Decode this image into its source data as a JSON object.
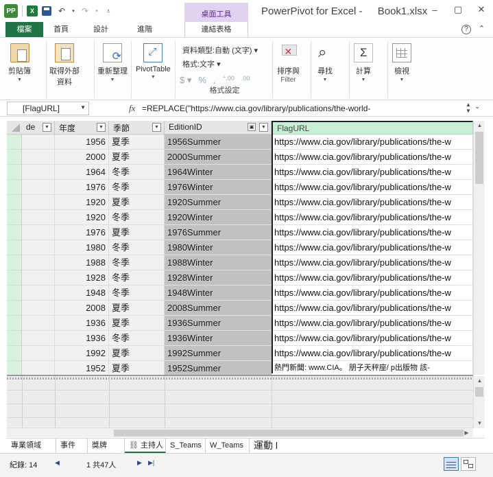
{
  "window": {
    "app_title": "PowerPivot for Excel -",
    "doc_title": "Book1.xlsx",
    "minimize": "–",
    "restore": "▢",
    "close": "✕"
  },
  "qat": {
    "logo": "PP",
    "excel": "X"
  },
  "ribbon_tabs": {
    "file": "檔案",
    "home": "首頁",
    "design": "設計",
    "advanced": "進階",
    "context_header": "桌面工具",
    "context_tab": "連結表格",
    "help": "?",
    "collapse": "⌃"
  },
  "ribbon": {
    "paste": "剪貼簿",
    "get_data_1": "取得外部",
    "get_data_2": "資料",
    "refresh": "重新整理",
    "pivottable": "PivotTable",
    "data_type": "資料類型:自動 (文字) ▾",
    "format": "格式:文字 ▾",
    "format_group": "格式設定",
    "sort_filter": "排序與",
    "filter": "Filter",
    "find": "尋找",
    "calculations": "計算",
    "view": "檢視"
  },
  "formula_bar": {
    "name_box": "[FlagURL]",
    "fx": "fx",
    "formula": "=REPLACE(\"https://www.cia.gov/library/publications/the-world-"
  },
  "columns": {
    "code": "de",
    "year": "年度",
    "season": "季節",
    "edition": "EditionID",
    "flag": "FlagURL"
  },
  "rows": [
    {
      "year": "1956",
      "season": "夏季",
      "edition": "1956Summer",
      "flag": "https://www.cia.gov/library/publications/the-w"
    },
    {
      "year": "2000",
      "season": "夏季",
      "edition": "2000Summer",
      "flag": "https://www.cia.gov/library/publications/the-w"
    },
    {
      "year": "1964",
      "season": "冬季",
      "edition": "1964Winter",
      "flag": "https://www.cia.gov/library/publications/the-w"
    },
    {
      "year": "1976",
      "season": "冬季",
      "edition": "1976Winter",
      "flag": "https://www.cia.gov/library/publications/the-w"
    },
    {
      "year": "1920",
      "season": "夏季",
      "edition": "1920Summer",
      "flag": "https://www.cia.gov/library/publications/the-w"
    },
    {
      "year": "1920",
      "season": "冬季",
      "edition": "1920Winter",
      "flag": "https://www.cia.gov/library/publications/the-w"
    },
    {
      "year": "1976",
      "season": "夏季",
      "edition": "1976Summer",
      "flag": "https://www.cia.gov/library/publications/the-w"
    },
    {
      "year": "1980",
      "season": "冬季",
      "edition": "1980Winter",
      "flag": "https://www.cia.gov/library/publications/the-w"
    },
    {
      "year": "1988",
      "season": "冬季",
      "edition": "1988Winter",
      "flag": "https://www.cia.gov/library/publications/the-w"
    },
    {
      "year": "1928",
      "season": "冬季",
      "edition": "1928Winter",
      "flag": "https://www.cia.gov/library/publications/the-w"
    },
    {
      "year": "1948",
      "season": "冬季",
      "edition": "1948Winter",
      "flag": "https://www.cia.gov/library/publications/the-w"
    },
    {
      "year": "2008",
      "season": "夏季",
      "edition": "2008Summer",
      "flag": "https://www.cia.gov/library/publications/the-w"
    },
    {
      "year": "1936",
      "season": "夏季",
      "edition": "1936Summer",
      "flag": "https://www.cia.gov/library/publications/the-w"
    },
    {
      "year": "1936",
      "season": "冬季",
      "edition": "1936Winter",
      "flag": "https://www.cia.gov/library/publications/the-w"
    },
    {
      "year": "1992",
      "season": "夏季",
      "edition": "1992Summer",
      "flag": "https://www.cia.gov/library/publications/the-w"
    },
    {
      "year": "1952",
      "season": "夏季",
      "edition": "1952Summer",
      "flag": "熱門新聞: www.CIA。 朋子天秤座/ p出版物 該-"
    }
  ],
  "sheet_tabs": [
    "專業領域",
    "事件",
    "獎牌",
    "主持人",
    "S_Teams",
    "W_Teams",
    "運動 l"
  ],
  "status": {
    "records_label": "紀錄: 14",
    "page": "1 共47人"
  },
  "colors": {
    "accent": "#217346",
    "context": "#e2d2f2",
    "selected_col": "#c7eed6"
  }
}
